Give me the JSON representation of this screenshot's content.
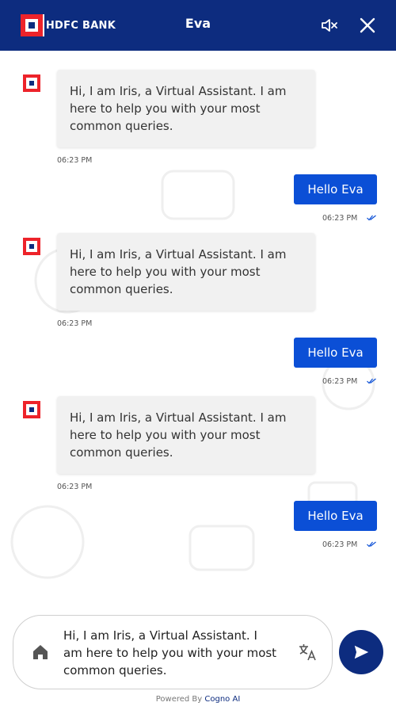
{
  "header": {
    "brand_name": "HDFC BANK",
    "title": "Eva",
    "icons": [
      "hdfc-logo",
      "mute-icon",
      "close-icon"
    ],
    "background": "#0d2c7f"
  },
  "messages": [
    {
      "from": "bot",
      "text": "Hi, I am Iris, a Virtual Assistant. I am here to help you with your most common queries.",
      "time": "06:23 PM"
    },
    {
      "from": "user",
      "text": "Hello Eva",
      "time": "06:23 PM"
    },
    {
      "from": "bot",
      "text": "Hi, I am Iris, a Virtual Assistant. I am here to help you with your most common queries.",
      "time": "06:23 PM"
    },
    {
      "from": "user",
      "text": "Hello Eva",
      "time": "06:23 PM"
    },
    {
      "from": "bot",
      "text": "Hi, I am Iris, a Virtual Assistant. I am here to help you with your most common queries.",
      "time": "06:23 PM"
    },
    {
      "from": "user",
      "text": "Hello Eva",
      "time": "06:23 PM"
    }
  ],
  "composer": {
    "value": "Hi, I am Iris, a Virtual Assistant. I am here to help you with your most common queries.",
    "icons": [
      "home-icon",
      "translate-icon",
      "send-icon"
    ]
  },
  "footer": {
    "powered_by": "Powered By",
    "vendor": "Cogno AI"
  },
  "colors": {
    "accent": "#0b4fd6",
    "brand_red": "#ed232a",
    "navy": "#0d2c7f"
  }
}
